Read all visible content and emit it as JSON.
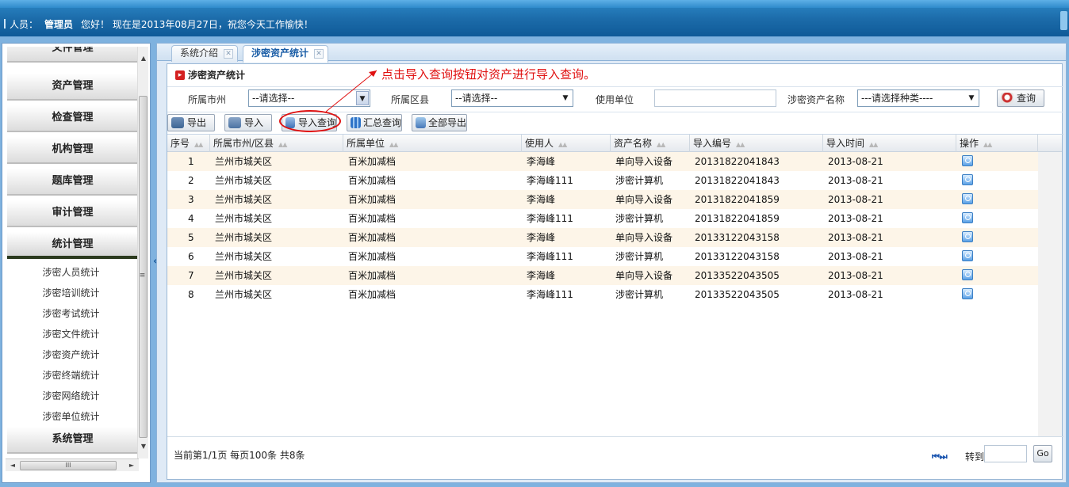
{
  "header": {
    "user_label": "人员：",
    "user_name": "管理员",
    "greeting": "您好！  现在是2013年08月27日，祝您今天工作愉快！"
  },
  "sidebar": {
    "menus": [
      {
        "label": "文件管理"
      },
      {
        "label": "资产管理"
      },
      {
        "label": "检查管理"
      },
      {
        "label": "机构管理"
      },
      {
        "label": "题库管理"
      },
      {
        "label": "审计管理"
      },
      {
        "label": "统计管理"
      }
    ],
    "submenu": [
      {
        "label": "涉密人员统计"
      },
      {
        "label": "涉密培训统计"
      },
      {
        "label": "涉密考试统计"
      },
      {
        "label": "涉密文件统计"
      },
      {
        "label": "涉密资产统计"
      },
      {
        "label": "涉密终端统计"
      },
      {
        "label": "涉密网络统计"
      },
      {
        "label": "涉密单位统计"
      }
    ],
    "last_menu": "系统管理",
    "collapse_glyph": "«",
    "grip": "≡",
    "hgrip": "III"
  },
  "tabs": [
    {
      "label": "系统介绍",
      "active": false
    },
    {
      "label": "涉密资产统计",
      "active": true
    }
  ],
  "panel": {
    "title": "涉密资产统计",
    "annotation": "点击导入查询按钮对资产进行导入查询。"
  },
  "filters": {
    "city_label": "所属市州",
    "city_value": "--请选择--",
    "district_label": "所属区县",
    "district_value": "--请选择--",
    "unit_label": "使用单位",
    "unit_value": "",
    "asset_label": "涉密资产名称",
    "asset_value": "---请选择种类----",
    "search_label": "查询"
  },
  "toolbar": {
    "export": "导出",
    "import": "导入",
    "import_query": "导入查询",
    "summary_query": "汇总查询",
    "export_all": "全部导出"
  },
  "grid": {
    "columns": [
      "序号",
      "所属市州/区县",
      "所属单位",
      "使用人",
      "资产名称",
      "导入编号",
      "导入时间",
      "操作"
    ],
    "sort_glyph": "▲▲",
    "rows": [
      {
        "no": "1",
        "area": "兰州市城关区",
        "unit": "百米加减档",
        "user": "李海峰",
        "asset": "单向导入设备",
        "code": "20131822041843",
        "time": "2013-08-21"
      },
      {
        "no": "2",
        "area": "兰州市城关区",
        "unit": "百米加减档",
        "user": "李海峰111",
        "asset": "涉密计算机",
        "code": "20131822041843",
        "time": "2013-08-21"
      },
      {
        "no": "3",
        "area": "兰州市城关区",
        "unit": "百米加减档",
        "user": "李海峰",
        "asset": "单向导入设备",
        "code": "20131822041859",
        "time": "2013-08-21"
      },
      {
        "no": "4",
        "area": "兰州市城关区",
        "unit": "百米加减档",
        "user": "李海峰111",
        "asset": "涉密计算机",
        "code": "20131822041859",
        "time": "2013-08-21"
      },
      {
        "no": "5",
        "area": "兰州市城关区",
        "unit": "百米加减档",
        "user": "李海峰",
        "asset": "单向导入设备",
        "code": "20133122043158",
        "time": "2013-08-21"
      },
      {
        "no": "6",
        "area": "兰州市城关区",
        "unit": "百米加减档",
        "user": "李海峰111",
        "asset": "涉密计算机",
        "code": "20133122043158",
        "time": "2013-08-21"
      },
      {
        "no": "7",
        "area": "兰州市城关区",
        "unit": "百米加减档",
        "user": "李海峰",
        "asset": "单向导入设备",
        "code": "20133522043505",
        "time": "2013-08-21"
      },
      {
        "no": "8",
        "area": "兰州市城关区",
        "unit": "百米加减档",
        "user": "李海峰111",
        "asset": "涉密计算机",
        "code": "20133522043505",
        "time": "2013-08-21"
      }
    ]
  },
  "pager": {
    "info": "当前第1/1页  每页100条  共8条",
    "nav_glyph": "⏮ ⏭",
    "goto_label": "转到",
    "go_label": "Go"
  },
  "colors": {
    "accent": "#1b6aa8",
    "annotation": "#e01010",
    "row_alt": "#fdf5e8"
  }
}
